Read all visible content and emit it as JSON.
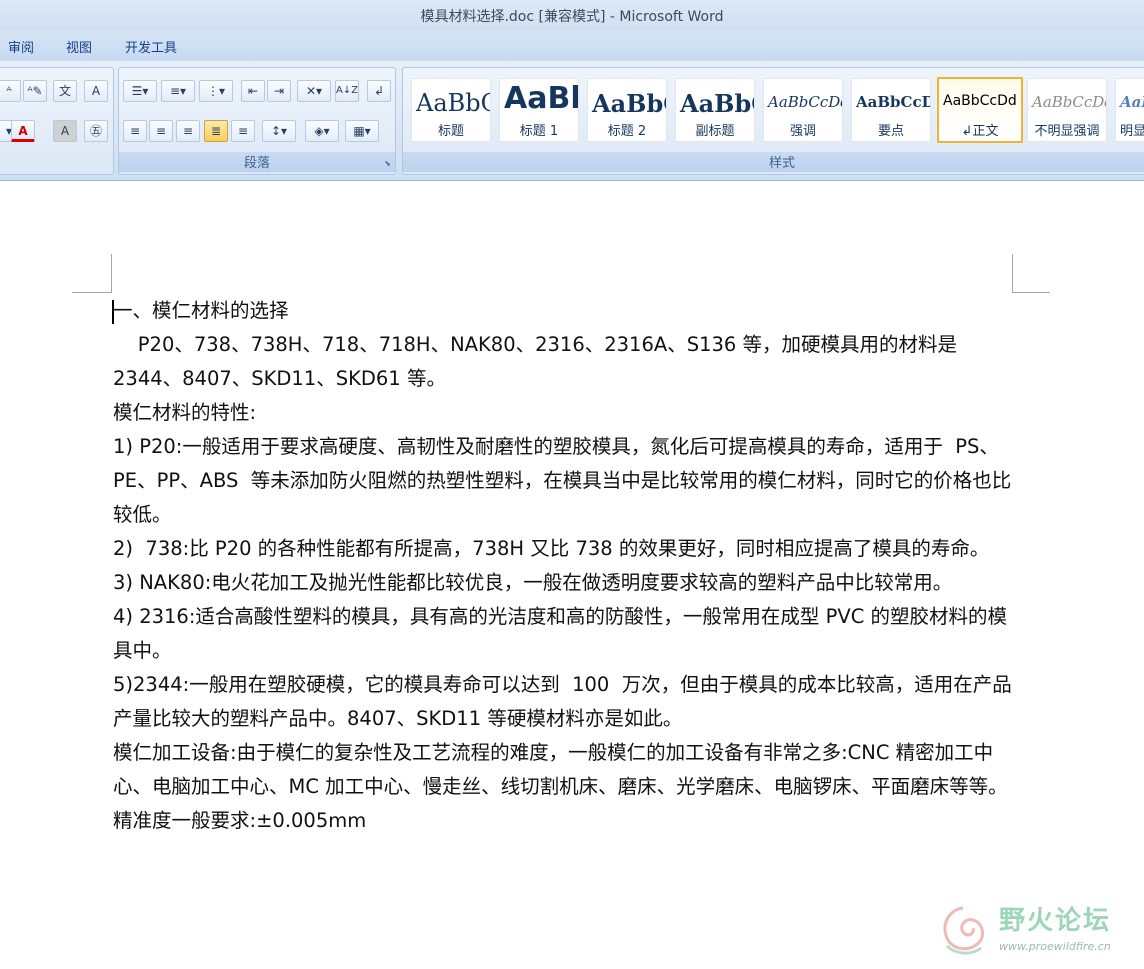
{
  "window": {
    "title": "模具材料选择.doc [兼容模式] - Microsoft Word"
  },
  "tabs": [
    {
      "label": "审阅"
    },
    {
      "label": "视图"
    },
    {
      "label": "开发工具"
    }
  ],
  "ribbon": {
    "paragraph_group_label": "段落",
    "styles_group_label": "样式",
    "font_color_label": "A",
    "sort_label": "A↓Z"
  },
  "styles": [
    {
      "sample": "AaBbC",
      "name": "标题"
    },
    {
      "sample": "AaBb",
      "name": "标题 1"
    },
    {
      "sample": "AaBbC",
      "name": "标题 2"
    },
    {
      "sample": "AaBbC",
      "name": "副标题"
    },
    {
      "sample": "AaBbCcDd",
      "name": "强调"
    },
    {
      "sample": "AaBbCcD",
      "name": "要点"
    },
    {
      "sample": "AaBbCcDd",
      "name": "↲正文"
    },
    {
      "sample": "AaBbCcDd",
      "name": "不明显强调"
    },
    {
      "sample": "AaB",
      "name": "明显"
    }
  ],
  "document": {
    "paragraphs": [
      "一、模仁材料的选择",
      "    P20、738、738H、718、718H、NAK80、2316、2316A、S136 等，加硬模具用的材料是 2344、8407、SKD11、SKD61 等。",
      "模仁材料的特性:",
      "1) P20:一般适用于要求高硬度、高韧性及耐磨性的塑胶模具，氮化后可提高模具的寿命，适用于  PS、PE、PP、ABS  等未添加防火阻燃的热塑性塑料，在模具当中是比较常用的模仁材料，同时它的价格也比较低。",
      "2)  738:比 P20 的各种性能都有所提高，738H 又比 738 的效果更好，同时相应提高了模具的寿命。",
      "3) NAK80:电火花加工及抛光性能都比较优良，一般在做透明度要求较高的塑料产品中比较常用。",
      "4) 2316:适合高酸性塑料的模具，具有高的光洁度和高的防酸性，一般常用在成型 PVC 的塑胶材料的模具中。",
      "5)2344:一般用在塑胶硬模，它的模具寿命可以达到  100  万次，但由于模具的成本比较高，适用在产品产量比较大的塑料产品中。8407、SKD11 等硬模材料亦是如此。",
      "模仁加工设备:由于模仁的复杂性及工艺流程的难度，一般模仁的加工设备有非常之多:CNC 精密加工中心、电脑加工中心、MC 加工中心、慢走丝、线切割机床、磨床、光学磨床、电脑锣床、平面磨床等等。",
      "精准度一般要求:±0.005mm"
    ]
  },
  "watermark": {
    "text": "野火论坛",
    "url": "www.proewildfire.cn"
  }
}
